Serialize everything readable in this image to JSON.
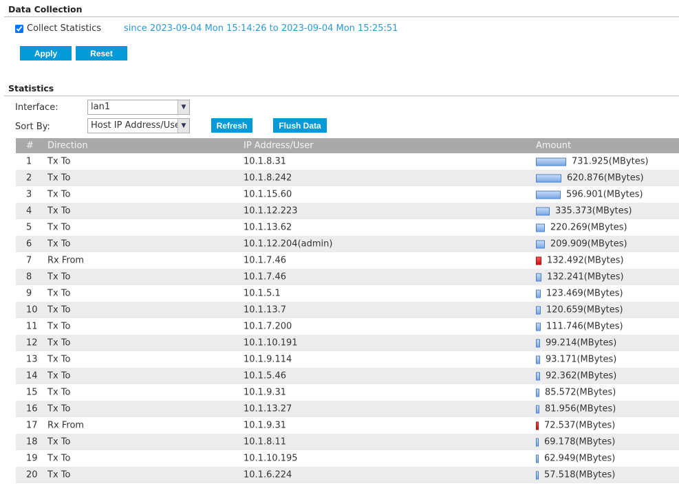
{
  "data_collection": {
    "title": "Data Collection",
    "collect_label": "Collect Statistics",
    "collect_checked": true,
    "since_text": "since 2023-09-04 Mon 15:14:26 to 2023-09-04 Mon 15:25:51",
    "apply": "Apply",
    "reset": "Reset"
  },
  "statistics": {
    "title": "Statistics",
    "interface_label": "Interface:",
    "interface_value": "lan1",
    "sort_label": "Sort By:",
    "sort_value": "Host IP Address/User",
    "refresh": "Refresh",
    "flush": "Flush Data"
  },
  "table": {
    "headers": [
      "#",
      "Direction",
      "IP Address/User",
      "Amount"
    ],
    "rows": [
      {
        "n": "1",
        "dir": "Tx To",
        "ip": "10.1.8.31",
        "amount": 731.925,
        "text": "731.925(MBytes)"
      },
      {
        "n": "2",
        "dir": "Tx To",
        "ip": "10.1.8.242",
        "amount": 620.876,
        "text": "620.876(MBytes)"
      },
      {
        "n": "3",
        "dir": "Tx To",
        "ip": "10.1.15.60",
        "amount": 596.901,
        "text": "596.901(MBytes)"
      },
      {
        "n": "4",
        "dir": "Tx To",
        "ip": "10.1.12.223",
        "amount": 335.373,
        "text": "335.373(MBytes)"
      },
      {
        "n": "5",
        "dir": "Tx To",
        "ip": "10.1.13.62",
        "amount": 220.269,
        "text": "220.269(MBytes)"
      },
      {
        "n": "6",
        "dir": "Tx To",
        "ip": "10.1.12.204(admin)",
        "amount": 209.909,
        "text": "209.909(MBytes)"
      },
      {
        "n": "7",
        "dir": "Rx From",
        "ip": "10.1.7.46",
        "amount": 132.492,
        "text": "132.492(MBytes)"
      },
      {
        "n": "8",
        "dir": "Tx To",
        "ip": "10.1.7.46",
        "amount": 132.241,
        "text": "132.241(MBytes)"
      },
      {
        "n": "9",
        "dir": "Tx To",
        "ip": "10.1.5.1",
        "amount": 123.469,
        "text": "123.469(MBytes)"
      },
      {
        "n": "10",
        "dir": "Tx To",
        "ip": "10.1.13.7",
        "amount": 120.659,
        "text": "120.659(MBytes)"
      },
      {
        "n": "11",
        "dir": "Tx To",
        "ip": "10.1.7.200",
        "amount": 111.746,
        "text": "111.746(MBytes)"
      },
      {
        "n": "12",
        "dir": "Tx To",
        "ip": "10.1.10.191",
        "amount": 99.214,
        "text": "99.214(MBytes)"
      },
      {
        "n": "13",
        "dir": "Tx To",
        "ip": "10.1.9.114",
        "amount": 93.171,
        "text": "93.171(MBytes)"
      },
      {
        "n": "14",
        "dir": "Tx To",
        "ip": "10.1.5.46",
        "amount": 92.362,
        "text": "92.362(MBytes)"
      },
      {
        "n": "15",
        "dir": "Tx To",
        "ip": "10.1.9.31",
        "amount": 85.572,
        "text": "85.572(MBytes)"
      },
      {
        "n": "16",
        "dir": "Tx To",
        "ip": "10.1.13.27",
        "amount": 81.956,
        "text": "81.956(MBytes)"
      },
      {
        "n": "17",
        "dir": "Rx From",
        "ip": "10.1.9.31",
        "amount": 72.537,
        "text": "72.537(MBytes)"
      },
      {
        "n": "18",
        "dir": "Tx To",
        "ip": "10.1.8.11",
        "amount": 69.178,
        "text": "69.178(MBytes)"
      },
      {
        "n": "19",
        "dir": "Tx To",
        "ip": "10.1.10.195",
        "amount": 62.949,
        "text": "62.949(MBytes)"
      },
      {
        "n": "20",
        "dir": "Tx To",
        "ip": "10.1.6.224",
        "amount": 57.518,
        "text": "57.518(MBytes)"
      }
    ]
  },
  "colors": {
    "accent": "#049ad8",
    "link": "#2a9ad6",
    "tx_bar": "#7aa8e6",
    "rx_bar": "#d42020"
  }
}
